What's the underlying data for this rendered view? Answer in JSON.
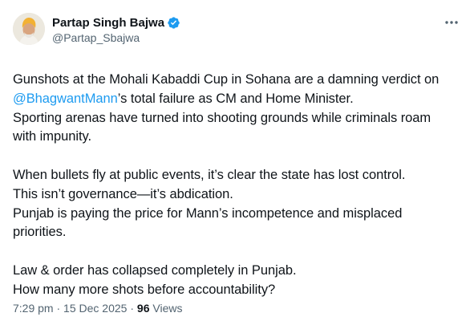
{
  "author": {
    "display_name": "Partap Singh Bajwa",
    "handle": "@Partap_Sbajwa",
    "verified": true,
    "verified_color": "#1d9bf0"
  },
  "menu_icon": "more-horizontal-icon",
  "tweet": {
    "line1": "Gunshots at the Mohali Kabaddi Cup in Sohana are a damning verdict on",
    "mention": "@BhagwantMann",
    "line2_rest": "’s  total failure as CM and Home Minister.",
    "line3": "Sporting arenas have turned into shooting grounds while criminals roam",
    "line4": "with impunity.",
    "line5": "When bullets fly at public events, it’s clear the state has lost control.",
    "line6": "This isn’t governance—it’s abdication.",
    "line7": "Punjab is paying the price for Mann’s incompetence and misplaced",
    "line8": "priorities.",
    "line9": "Law & order has collapsed completely in Punjab.",
    "line10": "How many more shots before accountability?"
  },
  "meta": {
    "time": "7:29 pm",
    "separator": "·",
    "date": "15 Dec 2025",
    "views_count": "96",
    "views_label": "Views"
  },
  "colors": {
    "text": "#0f1419",
    "secondary": "#536471",
    "link": "#1d9bf0"
  }
}
